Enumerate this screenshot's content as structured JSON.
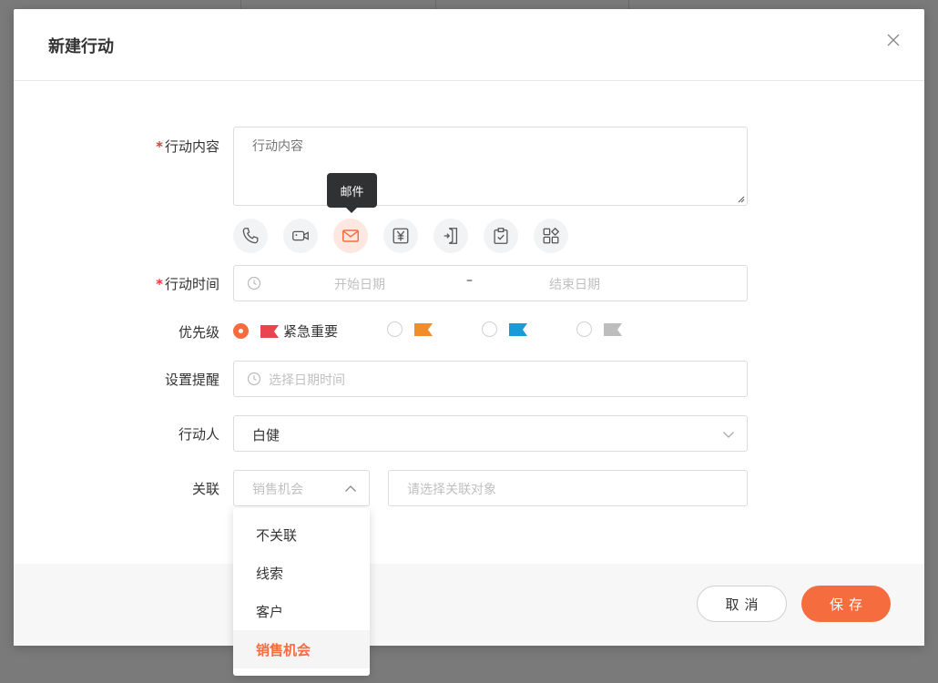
{
  "dialog": {
    "title": "新建行动"
  },
  "form": {
    "content": {
      "label": "行动内容",
      "placeholder": "行动内容"
    },
    "action_types": [
      {
        "name": "phone-icon",
        "tooltip": ""
      },
      {
        "name": "video-icon",
        "tooltip": ""
      },
      {
        "name": "mail-icon",
        "tooltip": "邮件",
        "active": true
      },
      {
        "name": "yuan-icon",
        "tooltip": ""
      },
      {
        "name": "door-enter-icon",
        "tooltip": ""
      },
      {
        "name": "clipboard-check-icon",
        "tooltip": ""
      },
      {
        "name": "apps-icon",
        "tooltip": ""
      }
    ],
    "tooltip_text": "邮件",
    "time": {
      "label": "行动时间",
      "start_placeholder": "开始日期",
      "separator": "–",
      "end_placeholder": "结束日期"
    },
    "priority": {
      "label": "优先级",
      "options": [
        {
          "label": "紧急重要",
          "flag_color": "#e8454e",
          "checked": true
        },
        {
          "label": "",
          "flag_color": "#ef8e2a",
          "checked": false
        },
        {
          "label": "",
          "flag_color": "#1a9ad6",
          "checked": false
        },
        {
          "label": "",
          "flag_color": "#bdbdbd",
          "checked": false
        }
      ]
    },
    "reminder": {
      "label": "设置提醒",
      "placeholder": "选择日期时间"
    },
    "assignee": {
      "label": "行动人",
      "value": "白健"
    },
    "relation": {
      "label": "关联",
      "type_placeholder": "销售机会",
      "target_placeholder": "请选择关联对象",
      "options": [
        "不关联",
        "线索",
        "客户",
        "销售机会"
      ],
      "selected": "销售机会"
    }
  },
  "footer": {
    "cancel_label": "取消",
    "save_label": "保存"
  },
  "colors": {
    "accent": "#f56c3f",
    "required": "#e23b3b"
  }
}
